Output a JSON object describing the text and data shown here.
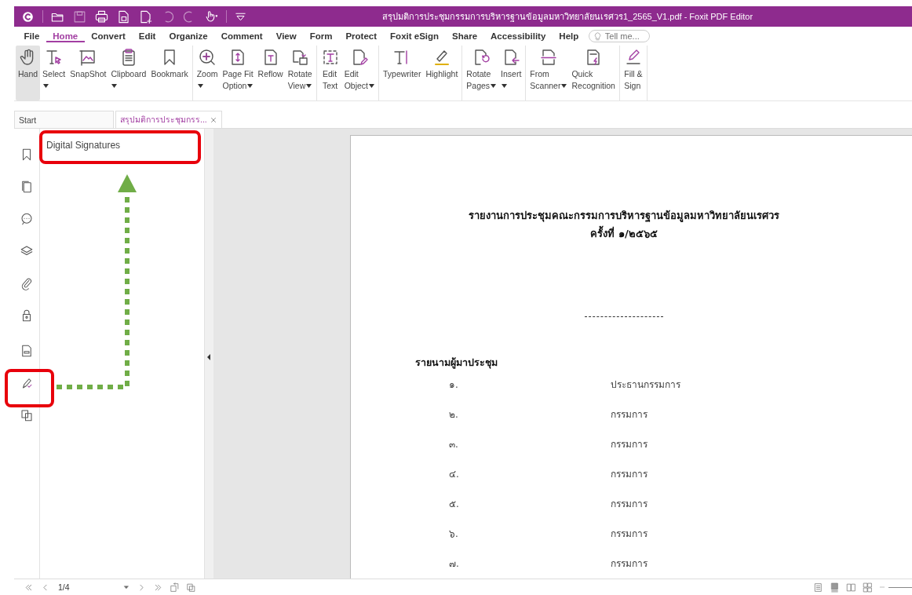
{
  "window": {
    "title": "สรุปมติการประชุมกรรมการบริหารฐานข้อมูลมหาวิทยาลัยนเรศวร1_2565_V1.pdf - Foxit PDF Editor"
  },
  "menu": [
    {
      "label": "File",
      "selected": false
    },
    {
      "label": "Home",
      "selected": true
    },
    {
      "label": "Convert",
      "selected": false
    },
    {
      "label": "Edit",
      "selected": false
    },
    {
      "label": "Organize",
      "selected": false
    },
    {
      "label": "Comment",
      "selected": false
    },
    {
      "label": "View",
      "selected": false
    },
    {
      "label": "Form",
      "selected": false
    },
    {
      "label": "Protect",
      "selected": false
    },
    {
      "label": "Foxit eSign",
      "selected": false
    },
    {
      "label": "Share",
      "selected": false
    },
    {
      "label": "Accessibility",
      "selected": false
    },
    {
      "label": "Help",
      "selected": false
    }
  ],
  "search": {
    "placeholder": "Tell me..."
  },
  "ribbon": {
    "groups": [
      {
        "buttons": [
          {
            "lines": [
              "Hand"
            ],
            "selected": true,
            "dropdown": false
          },
          {
            "lines": [
              "Select"
            ],
            "selected": false,
            "dropdown": true
          },
          {
            "lines": [
              "SnapShot"
            ],
            "selected": false,
            "dropdown": false
          },
          {
            "lines": [
              "Clipboard"
            ],
            "selected": false,
            "dropdown": true
          },
          {
            "lines": [
              "Bookmark"
            ],
            "selected": false,
            "dropdown": false
          }
        ]
      },
      {
        "buttons": [
          {
            "lines": [
              "Zoom"
            ],
            "selected": false,
            "dropdown": true
          },
          {
            "lines": [
              "Page Fit",
              "Option"
            ],
            "selected": false,
            "dropdown": true
          },
          {
            "lines": [
              "Reflow"
            ],
            "selected": false,
            "dropdown": false
          },
          {
            "lines": [
              "Rotate",
              "View"
            ],
            "selected": false,
            "dropdown": true
          }
        ]
      },
      {
        "buttons": [
          {
            "lines": [
              "Edit",
              "Text"
            ],
            "selected": false,
            "dropdown": false
          },
          {
            "lines": [
              "Edit",
              "Object"
            ],
            "selected": false,
            "dropdown": true
          }
        ]
      },
      {
        "buttons": [
          {
            "lines": [
              "Typewriter"
            ],
            "selected": false,
            "dropdown": false
          },
          {
            "lines": [
              "Highlight"
            ],
            "selected": false,
            "dropdown": false
          }
        ]
      },
      {
        "buttons": [
          {
            "lines": [
              "Rotate",
              "Pages"
            ],
            "selected": false,
            "dropdown": true
          },
          {
            "lines": [
              "Insert"
            ],
            "selected": false,
            "dropdown": true
          }
        ]
      },
      {
        "buttons": [
          {
            "lines": [
              "From",
              "Scanner"
            ],
            "selected": false,
            "dropdown": true
          },
          {
            "lines": [
              "Quick",
              "Recognition"
            ],
            "selected": false,
            "dropdown": false
          }
        ]
      },
      {
        "buttons": [
          {
            "lines": [
              "Fill &",
              "Sign"
            ],
            "selected": false,
            "dropdown": false
          }
        ]
      }
    ]
  },
  "doc_tabs": [
    {
      "label": "Start",
      "selected": false,
      "closable": false
    },
    {
      "label": "สรุปมติการประชุมกรร...",
      "selected": true,
      "closable": true
    }
  ],
  "sidebar": {
    "icons": [
      {
        "kind": "bookmark"
      },
      {
        "kind": "pages"
      },
      {
        "kind": "comment"
      },
      {
        "kind": "layers"
      },
      {
        "kind": "attachment"
      },
      {
        "kind": "security"
      },
      {
        "kind": "document"
      },
      {
        "kind": "signature"
      },
      {
        "kind": "compare"
      }
    ]
  },
  "panel": {
    "title": "Digital Signatures"
  },
  "document": {
    "title_lines": [
      "รายงานการประชุมคณะกรรมการบริหารฐานข้อมูลมหาวิทยาลัยนเรศวร",
      "ครั้งที่ ๑/๒๕๖๕"
    ],
    "heading": "รายนามผู้มาประชุม",
    "attendees": [
      {
        "number": "๑.",
        "role": "ประธานกรรมการ"
      },
      {
        "number": "๒.",
        "role": "กรรมการ"
      },
      {
        "number": "๓.",
        "role": "กรรมการ"
      },
      {
        "number": "๔.",
        "role": "กรรมการ"
      },
      {
        "number": "๕.",
        "role": "กรรมการ"
      },
      {
        "number": "๖.",
        "role": "กรรมการ"
      },
      {
        "number": "๗.",
        "role": "กรรมการ"
      }
    ]
  },
  "status_bar": {
    "page": "1/4"
  },
  "callouts": [
    {
      "kind": "box"
    },
    {
      "kind": "box"
    },
    {
      "kind": "arrow"
    }
  ]
}
